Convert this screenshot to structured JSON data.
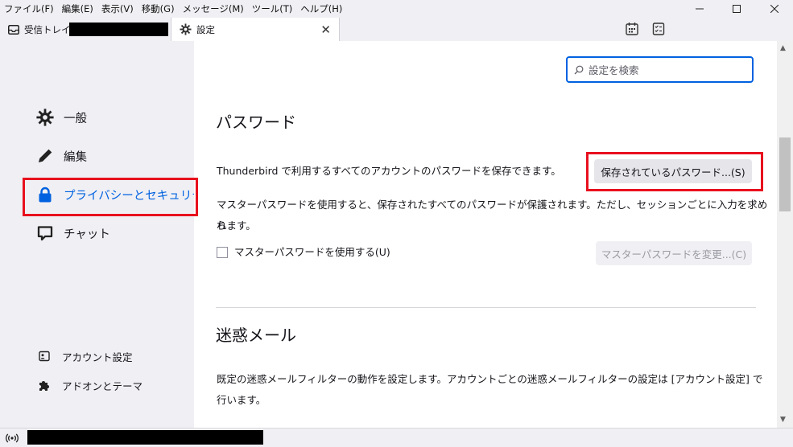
{
  "menubar": {
    "items": [
      "ファイル(F)",
      "編集(E)",
      "表示(V)",
      "移動(G)",
      "メッセージ(M)",
      "ツール(T)",
      "ヘルプ(H)"
    ]
  },
  "tabs": {
    "mail_label": "受信トレイ",
    "settings_label": "設定"
  },
  "sidebar": {
    "categories": [
      {
        "label": "一般",
        "icon": "gear-icon"
      },
      {
        "label": "編集",
        "icon": "pencil-icon"
      },
      {
        "label": "プライバシーとセキュリティ",
        "icon": "lock-icon",
        "active": true
      },
      {
        "label": "チャット",
        "icon": "chat-icon"
      }
    ],
    "footer": [
      {
        "label": "アカウント設定",
        "icon": "account-icon"
      },
      {
        "label": "アドオンとテーマ",
        "icon": "puzzle-icon"
      }
    ]
  },
  "search": {
    "placeholder": "設定を検索"
  },
  "password": {
    "heading": "パスワード",
    "description": "Thunderbird で利用するすべてのアカウントのパスワードを保存できます。",
    "saved_button": "保存されているパスワード...(S)",
    "master_desc_line1": "マスターパスワードを使用すると、保存されたすべてのパスワードが保護されます。ただし、セッションごとに入力を求めら",
    "master_desc_line2": "れます。",
    "use_master_label": "マスターパスワードを使用する(U)",
    "change_master_button": "マスターパスワードを変更...(C)"
  },
  "junk": {
    "heading": "迷惑メール",
    "desc_line1": "既定の迷惑メールフィルターの動作を設定します。アカウントごとの迷惑メールフィルターの設定は [アカウント設定] で",
    "desc_line2": "行います。"
  },
  "colors": {
    "accent": "#0061e0",
    "highlight": "#e8101e"
  }
}
